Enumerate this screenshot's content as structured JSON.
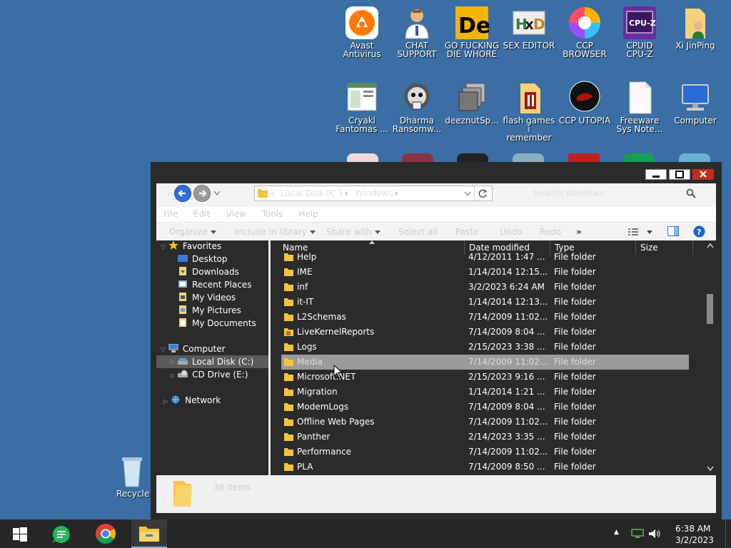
{
  "desktop": {
    "icons": [
      {
        "label": "Avast\nAntivirus",
        "icon": "avast-icon"
      },
      {
        "label": "CHAT\nSUPPORT",
        "icon": "chat-support-icon"
      },
      {
        "label": "GO FUCKING\nDIE WHORE",
        "icon": "de-icon"
      },
      {
        "label": "SEX EDITOR",
        "icon": "hxd-icon"
      },
      {
        "label": "CCP\nBROWSER",
        "icon": "ccp-browser-icon"
      },
      {
        "label": "CPUID\nCPU-Z",
        "icon": "cpuz-icon"
      },
      {
        "label": "Xi JinPing",
        "icon": "folder-user-icon"
      },
      {
        "label": "Cryakl\nFantomas ...",
        "icon": "cryakl-icon"
      },
      {
        "label": "Dharma\nRansomw...",
        "icon": "dharma-icon"
      },
      {
        "label": "deeznutSp...",
        "icon": "deeznut-icon"
      },
      {
        "label": "flash games i\nremember",
        "icon": "folder-flash-icon"
      },
      {
        "label": "CCP UTOPIA",
        "icon": "ccp-utopia-icon"
      },
      {
        "label": "Freeware\nSys Note...",
        "icon": "document-icon"
      },
      {
        "label": "Computer",
        "icon": "computer-icon"
      }
    ],
    "recycle": {
      "label": "Recycle",
      "icon": "recycle-bin-icon"
    }
  },
  "window": {
    "address": {
      "prefix": "«",
      "crumbs": [
        "Local Disk (C:)",
        "Windows"
      ]
    },
    "search_placeholder": "Search Windows",
    "menu": [
      "File",
      "Edit",
      "View",
      "Tools",
      "Help"
    ],
    "toolbar": {
      "organize": "Organize",
      "include": "Include in library",
      "share": "Share with",
      "select_all": "Select all",
      "paste": "Paste",
      "undo": "Undo",
      "redo": "Redo",
      "more": "»"
    },
    "nav": {
      "favorites": "Favorites",
      "favorites_items": [
        "Desktop",
        "Downloads",
        "Recent Places",
        "My Videos",
        "My Pictures",
        "My Documents"
      ],
      "computer": "Computer",
      "computer_items": [
        "Local Disk (C:)",
        "CD Drive (E:)"
      ],
      "network": "Network"
    },
    "columns": {
      "name": "Name",
      "date": "Date modified",
      "type": "Type",
      "size": "Size"
    },
    "rows": [
      {
        "name": "Help",
        "date": "4/12/2011 1:47 ...",
        "type": "File folder"
      },
      {
        "name": "IME",
        "date": "1/14/2014 12:15...",
        "type": "File folder"
      },
      {
        "name": "inf",
        "date": "3/2/2023 6:24 AM",
        "type": "File folder"
      },
      {
        "name": "it-IT",
        "date": "1/14/2014 12:13...",
        "type": "File folder"
      },
      {
        "name": "L2Schemas",
        "date": "7/14/2009 11:02...",
        "type": "File folder"
      },
      {
        "name": "LiveKernelReports",
        "date": "7/14/2009 8:04 ...",
        "type": "File folder"
      },
      {
        "name": "Logs",
        "date": "2/15/2023 3:38 ...",
        "type": "File folder"
      },
      {
        "name": "Media",
        "date": "7/14/2009 11:02...",
        "type": "File folder"
      },
      {
        "name": "Microsoft.NET",
        "date": "2/15/2023 9:16 ...",
        "type": "File folder"
      },
      {
        "name": "Migration",
        "date": "1/14/2014 1:21 ...",
        "type": "File folder"
      },
      {
        "name": "ModemLogs",
        "date": "7/14/2009 8:04 ...",
        "type": "File folder"
      },
      {
        "name": "Offline Web Pages",
        "date": "7/14/2009 11:02...",
        "type": "File folder"
      },
      {
        "name": "Panther",
        "date": "2/14/2023 3:35 ...",
        "type": "File folder"
      },
      {
        "name": "Performance",
        "date": "7/14/2009 11:02...",
        "type": "File folder"
      },
      {
        "name": "PLA",
        "date": "7/14/2009 8:50 ...",
        "type": "File folder"
      }
    ],
    "selected_row": "Media",
    "details": "38 items"
  },
  "taskbar": {
    "time": "6:38 AM",
    "date": "3/2/2023",
    "tray_chevron": "▲"
  },
  "colors": {
    "desktop": "#3a6ea5",
    "window_frame": "#2b2b2b",
    "selection": "#9b9b9b",
    "folder": "#f5c342",
    "taskbar": "#262626"
  }
}
